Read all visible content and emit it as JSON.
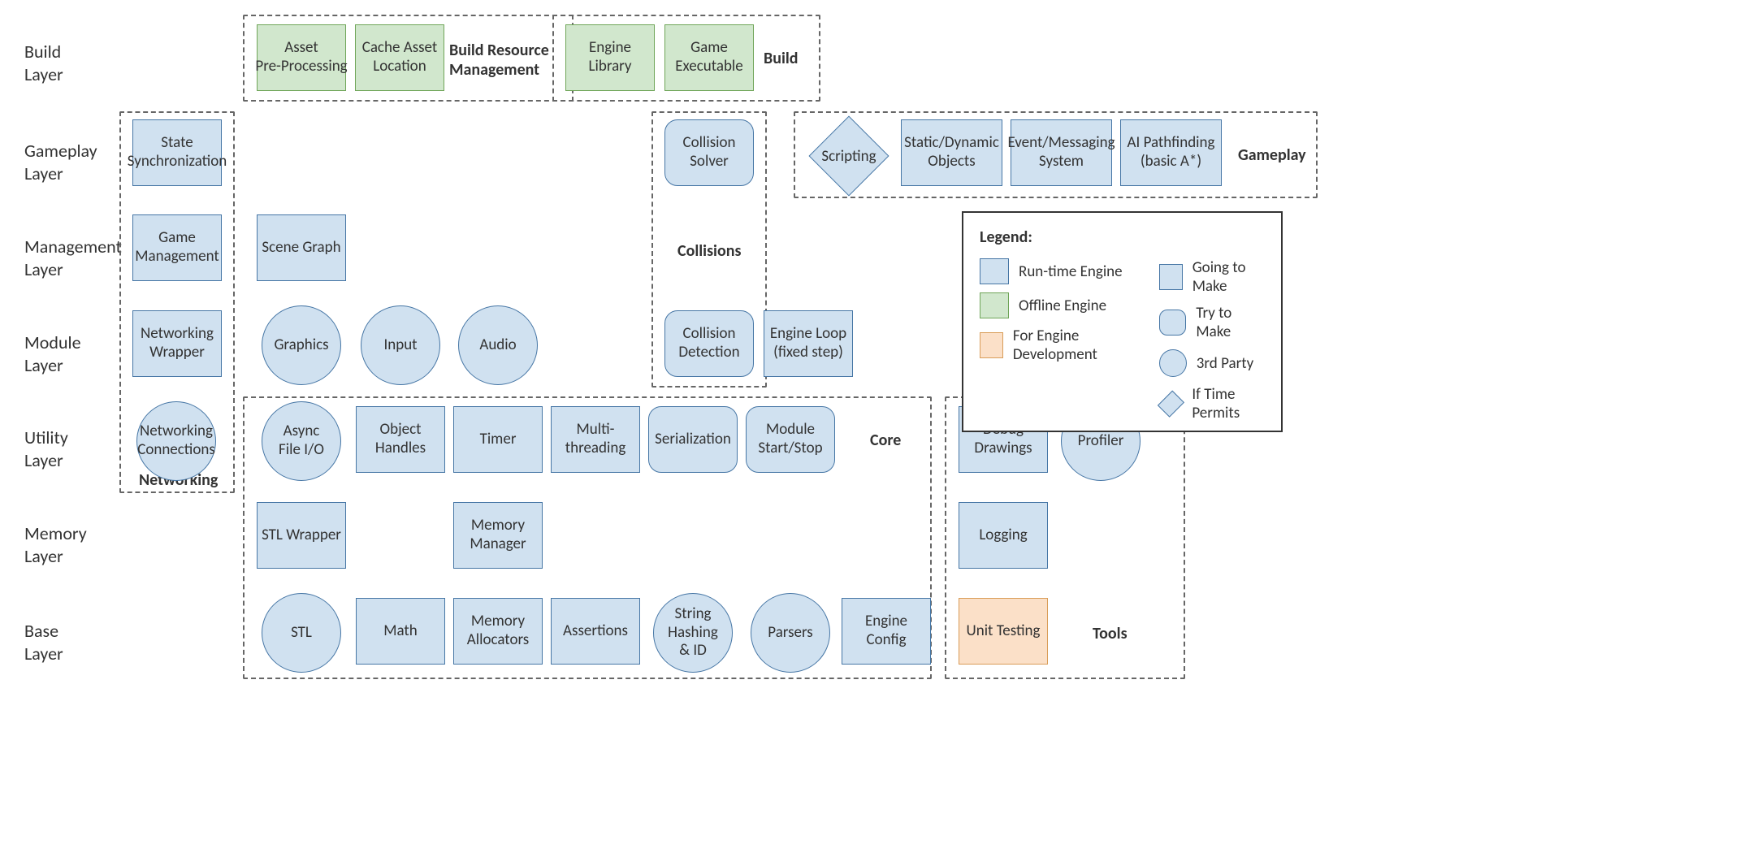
{
  "layers": {
    "build": "Build\nLayer",
    "gameplay": "Gameplay\nLayer",
    "management": "Management\nLayer",
    "module": "Module\nLayer",
    "utility": "Utility\nLayer",
    "memory": "Memory\nLayer",
    "base": "Base\nLayer"
  },
  "group_titles": {
    "build_resource_mgmt": "Build Resource\nManagement",
    "build": "Build",
    "gameplay": "Gameplay",
    "collisions": "Collisions",
    "networking": "Networking",
    "core": "Core",
    "tools": "Tools"
  },
  "nodes": {
    "asset_pre": "Asset\nPre-Processing",
    "cache_asset": "Cache Asset\nLocation",
    "engine_lib": "Engine Library",
    "game_exec": "Game\nExecutable",
    "state_sync": "State\nSynchronization",
    "collision_solver": "Collision\nSolver",
    "scripting": "Scripting",
    "static_dynamic": "Static/Dynamic\nObjects",
    "event_msg": "Event/Messaging\nSystem",
    "ai_path": "AI Pathfinding\n(basic A*)",
    "game_mgmt": "Game\nManagement",
    "scene_graph": "Scene Graph",
    "net_wrapper": "Networking\nWrapper",
    "graphics": "Graphics",
    "input": "Input",
    "audio": "Audio",
    "collision_detect": "Collision\nDetection",
    "engine_loop": "Engine Loop\n(fixed step)",
    "net_connections": "Networking\nConnections",
    "async_io": "Async\nFile I/O",
    "object_handles": "Object\nHandles",
    "timer": "Timer",
    "multithreading": "Multi-\nthreading",
    "serialization": "Serialization",
    "module_startstop": "Module\nStart/Stop",
    "debug_drawings": "Debug\nDrawings",
    "profiler": "Profiler",
    "stl_wrapper": "STL Wrapper",
    "mem_manager": "Memory\nManager",
    "logging": "Logging",
    "stl": "STL",
    "math": "Math",
    "mem_alloc": "Memory\nAllocators",
    "assertions": "Assertions",
    "string_hash": "String\nHashing\n& ID",
    "parsers": "Parsers",
    "engine_config": "Engine Config",
    "unit_testing": "Unit Testing"
  },
  "legend": {
    "title": "Legend:",
    "runtime": "Run-time Engine",
    "offline": "Offline Engine",
    "for_dev": "For Engine Development",
    "going_to_make": "Going to Make",
    "try_to_make": "Try to Make",
    "third_party": "3rd Party",
    "if_time": "If Time Permits"
  }
}
